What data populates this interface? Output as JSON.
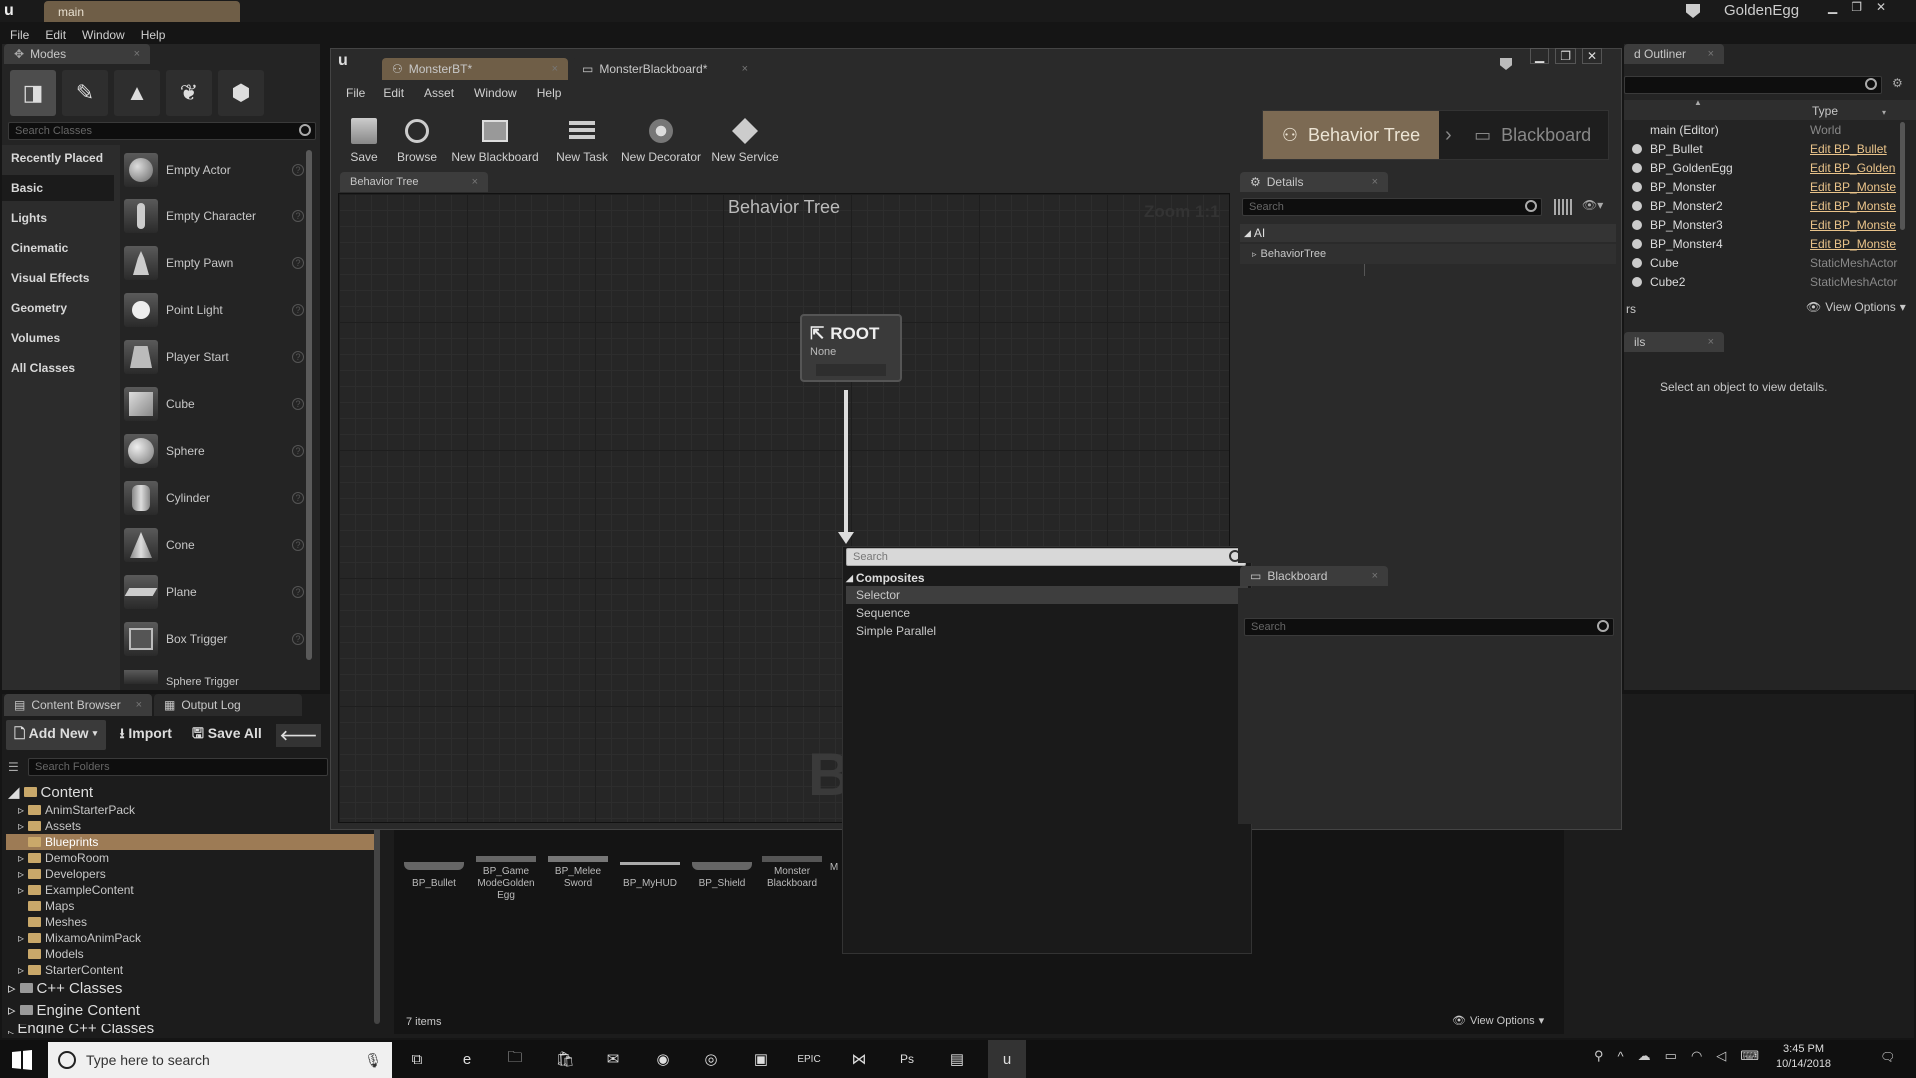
{
  "app": {
    "title": "main",
    "project": "GoldenEgg",
    "menu": [
      "File",
      "Edit",
      "Window",
      "Help"
    ]
  },
  "modes": {
    "tab": "Modes",
    "search_placeholder": "Search Classes",
    "categories": [
      "Recently Placed",
      "Basic",
      "Lights",
      "Cinematic",
      "Visual Effects",
      "Geometry",
      "Volumes",
      "All Classes"
    ],
    "items": [
      "Empty Actor",
      "Empty Character",
      "Empty Pawn",
      "Point Light",
      "Player Start",
      "Cube",
      "Sphere",
      "Cylinder",
      "Cone",
      "Plane",
      "Box Trigger",
      "Sphere Trigger"
    ]
  },
  "content": {
    "tabs": [
      "Content Browser",
      "Output Log"
    ],
    "add_new": "Add New",
    "import": "Import",
    "save_all": "Save All",
    "search_folders": "Search Folders",
    "root": "Content",
    "folders": [
      "AnimStarterPack",
      "Assets",
      "Blueprints",
      "DemoRoom",
      "Developers",
      "ExampleContent",
      "Maps",
      "Meshes",
      "MixamoAnimPack",
      "Models",
      "StarterContent"
    ],
    "cpp": "C++ Classes",
    "engine": "Engine Content",
    "engine_cpp": "Engine C++ Classes",
    "assets": [
      "BP_Bullet",
      "BP_Game ModeGolden Egg",
      "BP_Melee Sword",
      "BP_MyHUD",
      "BP_Shield",
      "Monster Blackboard",
      "M"
    ],
    "items_count": "7 items",
    "view_options": "View Options"
  },
  "bt": {
    "tabs": [
      "MonsterBT*",
      "MonsterBlackboard*"
    ],
    "menu": [
      "File",
      "Edit",
      "Asset",
      "Window",
      "Help"
    ],
    "toolbar": [
      "Save",
      "Browse",
      "New Blackboard",
      "New Task",
      "New Decorator",
      "New Service"
    ],
    "mode_bt": "Behavior Tree",
    "mode_bb": "Blackboard",
    "graph_tab": "Behavior Tree",
    "graph_title": "Behavior Tree",
    "zoom": "Zoom 1:1",
    "root_label": "ROOT",
    "root_sub": "None",
    "watermark": "B",
    "popup": {
      "search": "Search",
      "category": "Composites",
      "items": [
        "Selector",
        "Sequence",
        "Simple Parallel"
      ]
    },
    "details": {
      "tab": "Details",
      "search": "Search",
      "cat": "AI",
      "item": "BehaviorTree"
    },
    "blackboard": {
      "tab": "Blackboard",
      "search": "Search"
    }
  },
  "outliner": {
    "tab": "d Outliner",
    "col_type": "Type",
    "rows": [
      {
        "name": "main (Editor)",
        "type": "World"
      },
      {
        "name": "BP_Bullet",
        "type": "Edit BP_Bullet"
      },
      {
        "name": "BP_GoldenEgg",
        "type": "Edit BP_Golden"
      },
      {
        "name": "BP_Monster",
        "type": "Edit BP_Monste"
      },
      {
        "name": "BP_Monster2",
        "type": "Edit BP_Monste"
      },
      {
        "name": "BP_Monster3",
        "type": "Edit BP_Monste"
      },
      {
        "name": "BP_Monster4",
        "type": "Edit BP_Monste"
      },
      {
        "name": "Cube",
        "type": "StaticMeshActor"
      },
      {
        "name": "Cube2",
        "type": "StaticMeshActor"
      }
    ],
    "left_label": "rs",
    "view_options": "View Options",
    "details_tab": "ils",
    "details_msg": "Select an object to view details."
  },
  "taskbar": {
    "search": "Type here to search",
    "time": "3:45 PM",
    "date": "10/14/2018"
  }
}
